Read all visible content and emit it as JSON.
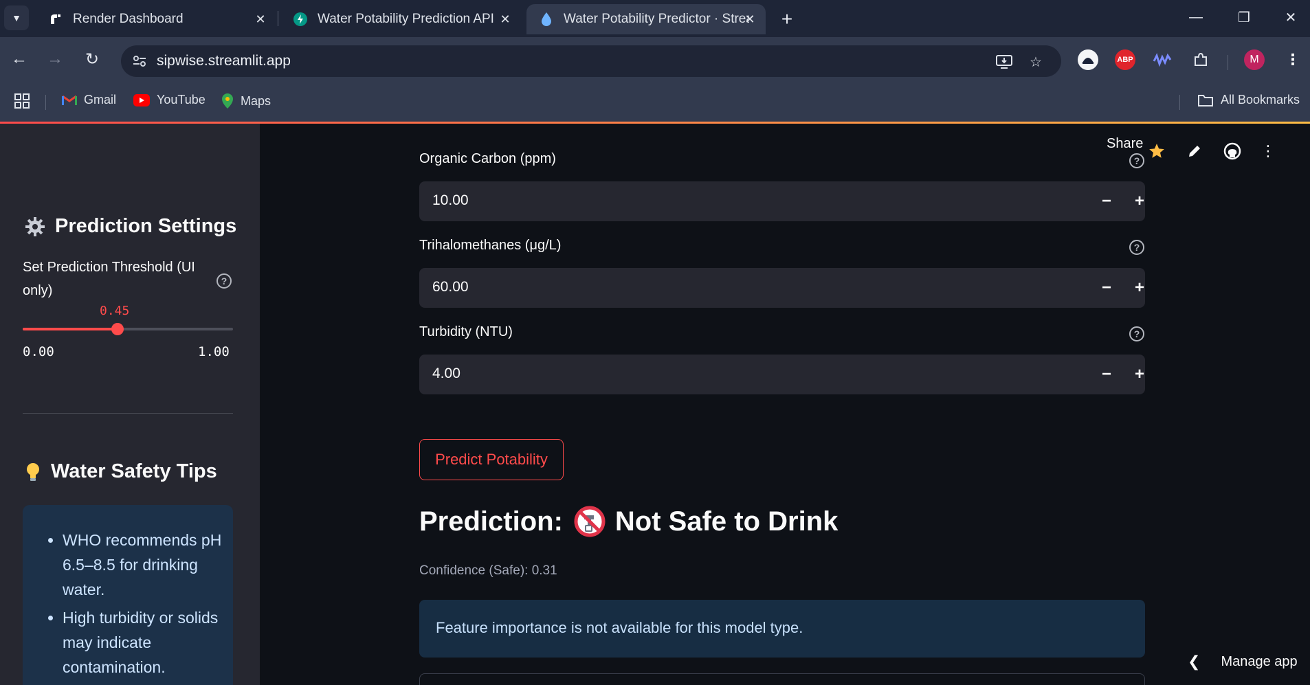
{
  "browser": {
    "tabs": [
      {
        "title": "Render Dashboard",
        "favicon": "render-icon",
        "active": false
      },
      {
        "title": "Water Potability Prediction API",
        "favicon": "fastapi-icon",
        "active": false
      },
      {
        "title": "Water Potability Predictor · Streamlit",
        "favicon": "droplet-icon",
        "active": true
      }
    ],
    "new_tab_label": "+",
    "url": "sipwise.streamlit.app",
    "bookmarks": [
      {
        "label": "Gmail",
        "icon": "gmail-icon"
      },
      {
        "label": "YouTube",
        "icon": "youtube-icon"
      },
      {
        "label": "Maps",
        "icon": "maps-icon"
      }
    ],
    "all_bookmarks_label": "All Bookmarks",
    "profile_initial": "M",
    "extensions": [
      "ghost-icon",
      "abp-icon",
      "wave-icon",
      "puzzle-icon"
    ],
    "abp_label": "ABP",
    "accent_gradient": [
      "#ff4b4b",
      "#ffbd45"
    ]
  },
  "sidebar": {
    "settings_title": "Prediction Settings",
    "settings_icon": "gear-icon",
    "threshold": {
      "label": "Set Prediction Threshold (UI only)",
      "value": 0.45,
      "value_text": "0.45",
      "min_text": "0.00",
      "max_text": "1.00"
    },
    "tips_title": "Water Safety Tips",
    "tips_icon": "lightbulb-icon",
    "tips": [
      "WHO recommends pH 6.5–8.5 for drinking water.",
      "High turbidity or solids may indicate contamination."
    ]
  },
  "header": {
    "share_label": "Share"
  },
  "main": {
    "fields": [
      {
        "label": "Organic Carbon (ppm)",
        "value": "10.00"
      },
      {
        "label": "Trihalomethanes (μg/L)",
        "value": "60.00"
      },
      {
        "label": "Turbidity (NTU)",
        "value": "4.00"
      }
    ],
    "stepper_minus": "−",
    "stepper_plus": "+",
    "predict_button": "Predict Potability",
    "prediction_prefix": "Prediction:",
    "prediction_result": "Not Safe to Drink",
    "confidence": "Confidence (Safe): 0.31",
    "info_message": "Feature importance is not available for this model type."
  },
  "footer": {
    "manage_label": "Manage app"
  },
  "colors": {
    "primary": "#ff4b4b",
    "sidebar_bg": "#262730",
    "main_bg": "#0e1117",
    "info_bg": "#172d43",
    "star": "#ffbd45"
  }
}
